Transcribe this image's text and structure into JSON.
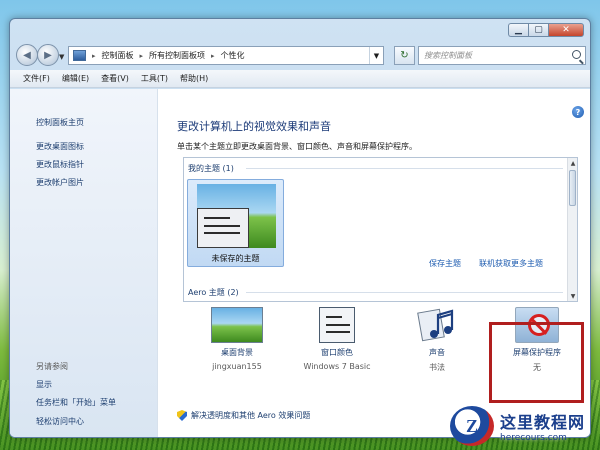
{
  "window": {
    "caption": {
      "minimize": "▁",
      "maximize": "▢",
      "close": "✕"
    }
  },
  "navbar": {
    "breadcrumb": [
      "控制面板",
      "所有控制面板项",
      "个性化"
    ],
    "separator": "▸",
    "search_placeholder": "搜索控制面板"
  },
  "menubar": {
    "items": [
      "文件(F)",
      "编辑(E)",
      "查看(V)",
      "工具(T)",
      "帮助(H)"
    ]
  },
  "sidebar": {
    "home": "控制面板主页",
    "links": [
      "更改桌面图标",
      "更改鼠标指针",
      "更改帐户图片"
    ],
    "see_also_heading": "另请参阅",
    "see_also": [
      "显示",
      "任务栏和「开始」菜单",
      "轻松访问中心"
    ]
  },
  "main": {
    "title": "更改计算机上的视觉效果和声音",
    "subtitle": "单击某个主题立即更改桌面背景、窗口颜色、声音和屏幕保护程序。",
    "my_themes_group": "我的主题 (1)",
    "unsaved_theme": "未保存的主题",
    "save_theme": "保存主题",
    "get_more_themes": "联机获取更多主题",
    "aero_group": "Aero 主题 (2)",
    "help_label": "?",
    "bottom_items": [
      {
        "label": "桌面背景",
        "sub": "jingxuan155"
      },
      {
        "label": "窗口颜色",
        "sub": "Windows 7 Basic"
      },
      {
        "label": "声音",
        "sub": "书法"
      },
      {
        "label": "屏幕保护程序",
        "sub": "无"
      }
    ],
    "fix_link": "解决透明度和其他 Aero 效果问题"
  },
  "watermark": {
    "name_cn": "这里教程网",
    "domain": "herecours.com",
    "logo_letter": "Z"
  },
  "colors": {
    "link": "#1e3f70",
    "title": "#1b3a78",
    "highlight": "#b01e1e"
  }
}
